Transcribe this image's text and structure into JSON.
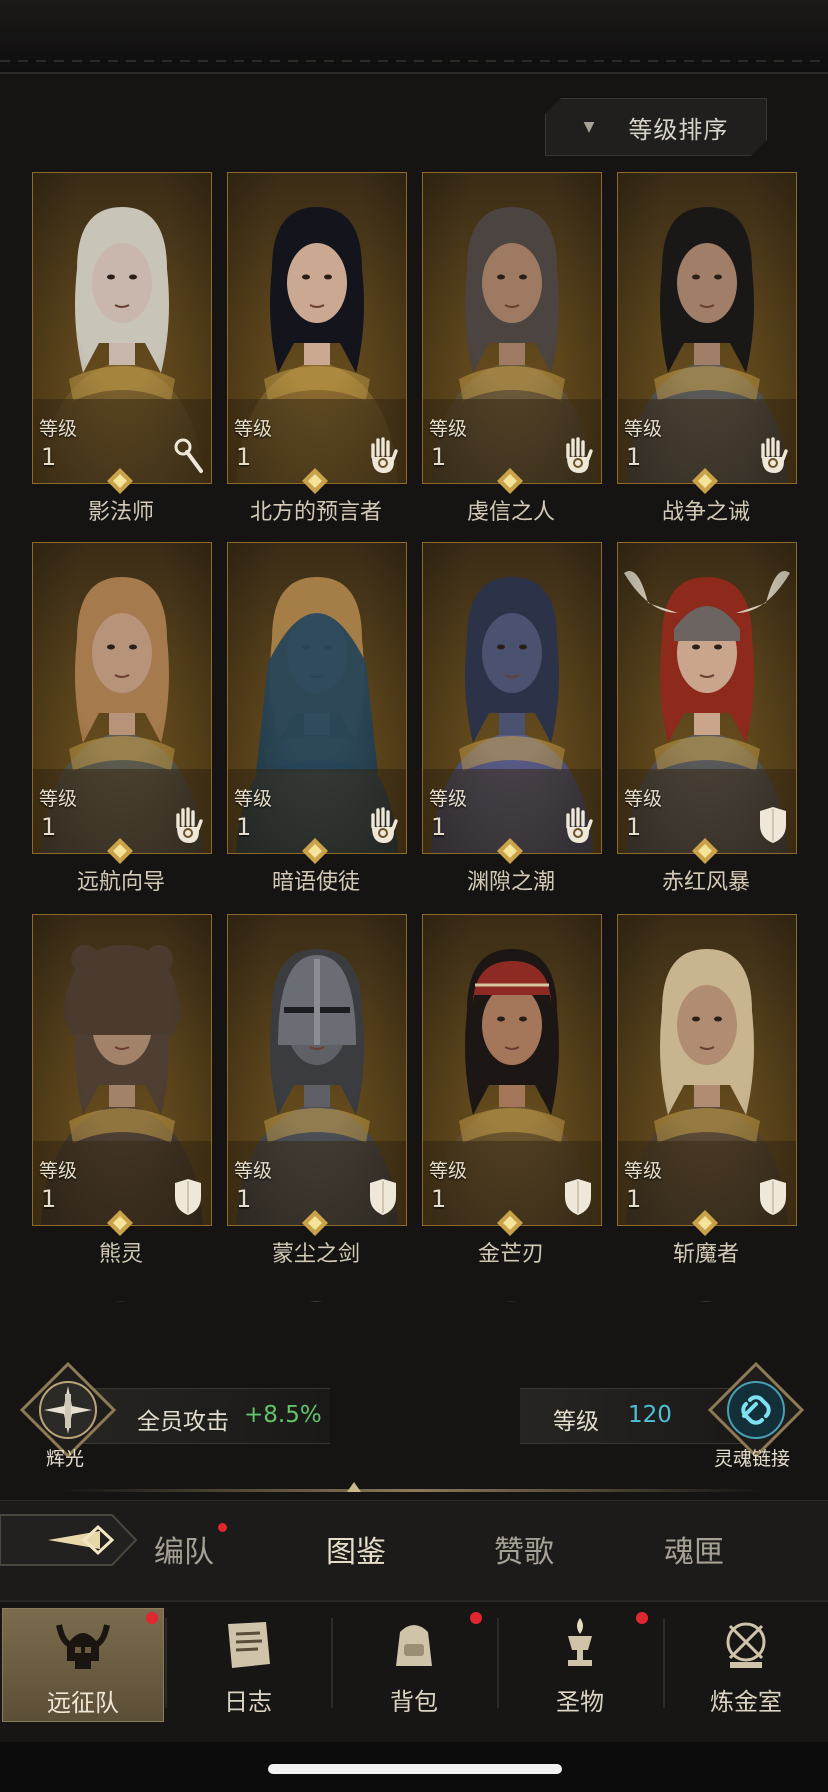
{
  "sort": {
    "label": "等级排序"
  },
  "level_label": "等级",
  "heroes": [
    {
      "name": "影法师",
      "level": "1",
      "class_icon": "staff-icon",
      "hair": "#c9c4b8",
      "skin": "#c9b7ae",
      "armor": "#7a5f2e",
      "helm": "none"
    },
    {
      "name": "北方的预言者",
      "level": "1",
      "class_icon": "hand-icon",
      "hair": "#14141c",
      "skin": "#caa891",
      "armor": "#8a6a30",
      "helm": "none"
    },
    {
      "name": "虔信之人",
      "level": "1",
      "class_icon": "hand-icon",
      "hair": "#4b4440",
      "skin": "#9e7a62",
      "armor": "#6b5a3a",
      "helm": "none"
    },
    {
      "name": "战争之诫",
      "level": "1",
      "class_icon": "hand-icon",
      "hair": "#1a1816",
      "skin": "#a07e68",
      "armor": "#5c5a58",
      "helm": "none"
    },
    {
      "name": "远航向导",
      "level": "1",
      "class_icon": "hand-icon",
      "hair": "#a57a4c",
      "skin": "#b7937a",
      "armor": "#5d5a4e",
      "helm": "none"
    },
    {
      "name": "暗语使徒",
      "level": "1",
      "class_icon": "hand-icon",
      "hair": "#a57d46",
      "skin": "#d2b59e",
      "armor": "#2d4a5c",
      "helm": "hood"
    },
    {
      "name": "渊隙之潮",
      "level": "1",
      "class_icon": "hand-icon",
      "hair": "#2c3248",
      "skin": "#4a5270",
      "armor": "#585a86",
      "helm": "none"
    },
    {
      "name": "赤红风暴",
      "level": "1",
      "class_icon": "shield-icon",
      "hair": "#8e2a1c",
      "skin": "#c9a58c",
      "armor": "#5a5a5c",
      "helm": "horned"
    },
    {
      "name": "熊灵",
      "level": "1",
      "class_icon": "shield-icon",
      "hair": "#4e3f32",
      "skin": "#a3826a",
      "armor": "#4d3f34",
      "helm": "bear"
    },
    {
      "name": "蒙尘之剑",
      "level": "1",
      "class_icon": "shield-icon",
      "hair": "#3a3c40",
      "skin": "#5e6066",
      "armor": "#4c4f55",
      "helm": "knight"
    },
    {
      "name": "金芒刃",
      "level": "1",
      "class_icon": "shield-icon",
      "hair": "#1c1714",
      "skin": "#a5775a",
      "armor": "#6b5530",
      "helm": "turban"
    },
    {
      "name": "斩魔者",
      "level": "1",
      "class_icon": "shield-icon",
      "hair": "#c8b590",
      "skin": "#b08d72",
      "armor": "#5a4a36",
      "helm": "none"
    }
  ],
  "bonus": {
    "radiance_caption": "辉光",
    "buff_label": "全员攻击",
    "buff_value": "+8.5%",
    "level_label": "等级",
    "level_value": "120",
    "soul_link_caption": "灵魂链接"
  },
  "subtabs": [
    {
      "label": "编队",
      "active": false,
      "dot": true
    },
    {
      "label": "图鉴",
      "active": true,
      "dot": false
    },
    {
      "label": "赞歌",
      "active": false,
      "dot": false
    },
    {
      "label": "魂匣",
      "active": false,
      "dot": false
    }
  ],
  "nav": [
    {
      "label": "远征队",
      "icon": "horned-helmet-icon",
      "active": true,
      "dot": true
    },
    {
      "label": "日志",
      "icon": "scroll-icon",
      "active": false,
      "dot": false
    },
    {
      "label": "背包",
      "icon": "backpack-icon",
      "active": false,
      "dot": true
    },
    {
      "label": "圣物",
      "icon": "chalice-icon",
      "active": false,
      "dot": true
    },
    {
      "label": "炼金室",
      "icon": "alchemy-icon",
      "active": false,
      "dot": false
    }
  ],
  "colors": {
    "accent_gold": "#c9a24a",
    "buff_green": "#62c46a",
    "level_cyan": "#4fc0d8",
    "notify_red": "#e0262f"
  }
}
